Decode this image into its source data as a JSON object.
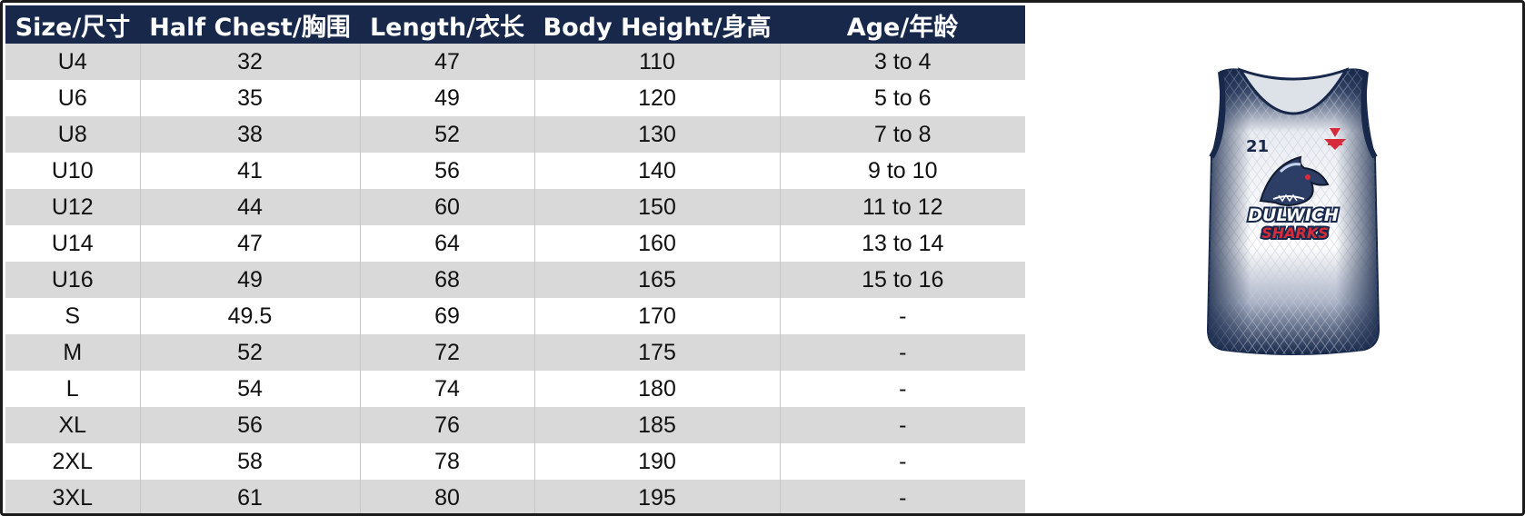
{
  "size_chart": {
    "headers": [
      "Size/尺寸",
      "Half Chest/胸围",
      "Length/衣长",
      "Body Height/身高",
      "Age/年龄"
    ],
    "rows": [
      [
        "U4",
        "32",
        "47",
        "110",
        "3 to 4"
      ],
      [
        "U6",
        "35",
        "49",
        "120",
        "5 to 6"
      ],
      [
        "U8",
        "38",
        "52",
        "130",
        "7 to 8"
      ],
      [
        "U10",
        "41",
        "56",
        "140",
        "9 to 10"
      ],
      [
        "U12",
        "44",
        "60",
        "150",
        "11 to 12"
      ],
      [
        "U14",
        "47",
        "64",
        "160",
        "13 to 14"
      ],
      [
        "U16",
        "49",
        "68",
        "165",
        "15 to 16"
      ],
      [
        "S",
        "49.5",
        "69",
        "170",
        "-"
      ],
      [
        "M",
        "52",
        "72",
        "175",
        "-"
      ],
      [
        "L",
        "54",
        "74",
        "180",
        "-"
      ],
      [
        "XL",
        "56",
        "76",
        "185",
        "-"
      ],
      [
        "2XL",
        "58",
        "78",
        "190",
        "-"
      ],
      [
        "3XL",
        "61",
        "80",
        "195",
        "-"
      ]
    ]
  },
  "jersey": {
    "number": "21",
    "logo_line1": "DULWICH",
    "logo_line2": "SHARKS",
    "colors": {
      "navy": "#17284a",
      "logo_red": "#d52b3a",
      "white": "#ffffff"
    }
  },
  "colors": {
    "header_bg": "#17284a",
    "header_text": "#ffffff",
    "row_alt_bg": "#d9d9d9",
    "row_bg": "#ffffff"
  }
}
